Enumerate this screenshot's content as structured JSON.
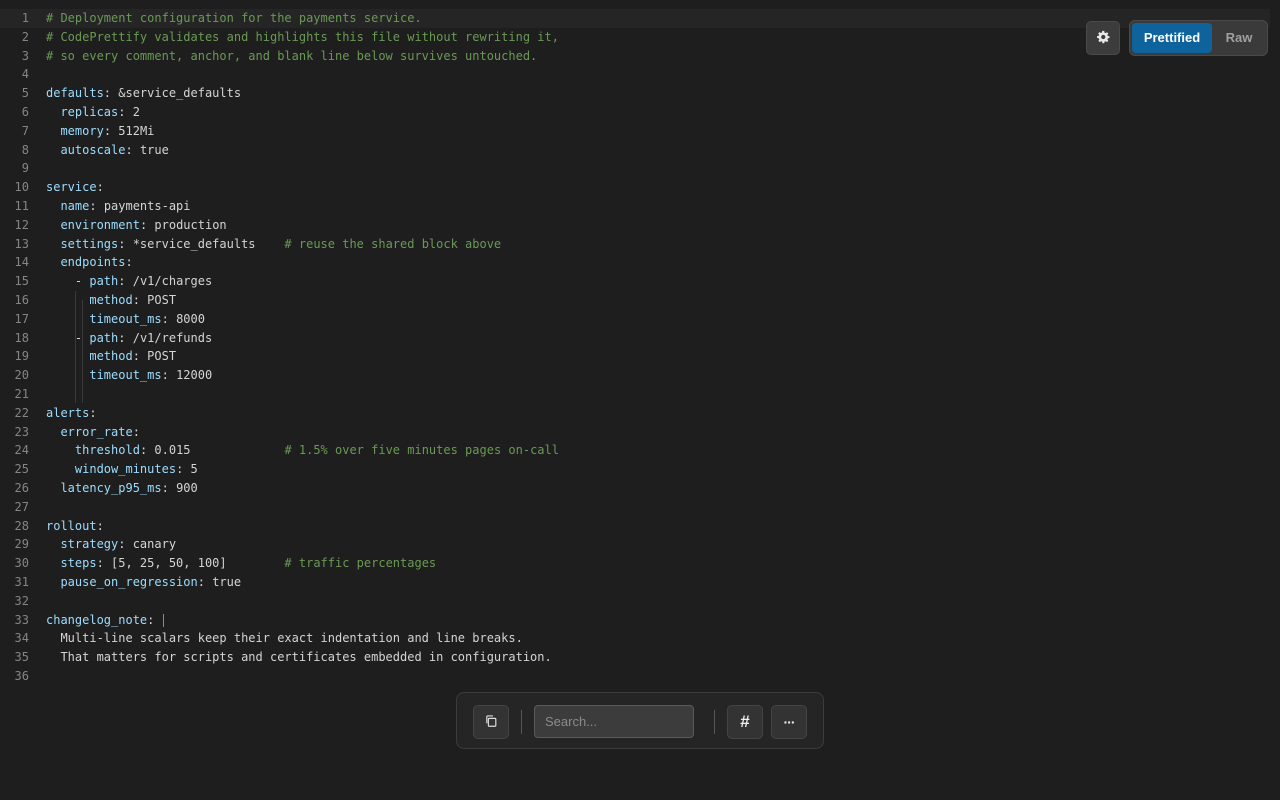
{
  "toolbar": {
    "prettified_label": "Prettified",
    "raw_label": "Raw",
    "active_view": "Prettified",
    "settings_icon": "gear-icon"
  },
  "search": {
    "placeholder": "Search..."
  },
  "bottom_bar": {
    "copy_icon": "copy-icon",
    "line_numbers_icon": "hash-icon",
    "line_numbers_glyph": "#",
    "more_icon": "more-icon",
    "more_glyph": "···"
  },
  "colors": {
    "background": "#1e1e1e",
    "comment": "#6a9955",
    "key": "#9cdcfe",
    "accent": "#0e639c"
  },
  "editor": {
    "current_line": 1,
    "lines": [
      {
        "n": "1",
        "tokens": [
          {
            "c": "comment",
            "t": "# Deployment configuration for the payments service."
          }
        ]
      },
      {
        "n": "2",
        "tokens": [
          {
            "c": "comment",
            "t": "# CodePrettify validates and highlights this file without rewriting it,"
          }
        ]
      },
      {
        "n": "3",
        "tokens": [
          {
            "c": "comment",
            "t": "# so every comment, anchor, and blank line below survives untouched."
          }
        ]
      },
      {
        "n": "4",
        "tokens": []
      },
      {
        "n": "5",
        "tokens": [
          {
            "c": "key",
            "t": "defaults"
          },
          {
            "c": "punct",
            "t": ": "
          },
          {
            "c": "val",
            "t": "&service_defaults"
          }
        ]
      },
      {
        "n": "6",
        "tokens": [
          {
            "c": "val",
            "t": "  "
          },
          {
            "c": "key",
            "t": "replicas"
          },
          {
            "c": "punct",
            "t": ": "
          },
          {
            "c": "val",
            "t": "2"
          }
        ]
      },
      {
        "n": "7",
        "tokens": [
          {
            "c": "val",
            "t": "  "
          },
          {
            "c": "key",
            "t": "memory"
          },
          {
            "c": "punct",
            "t": ": "
          },
          {
            "c": "val",
            "t": "512Mi"
          }
        ]
      },
      {
        "n": "8",
        "tokens": [
          {
            "c": "val",
            "t": "  "
          },
          {
            "c": "key",
            "t": "autoscale"
          },
          {
            "c": "punct",
            "t": ": "
          },
          {
            "c": "val",
            "t": "true"
          }
        ]
      },
      {
        "n": "9",
        "tokens": []
      },
      {
        "n": "10",
        "tokens": [
          {
            "c": "key",
            "t": "service"
          },
          {
            "c": "punct",
            "t": ":"
          }
        ]
      },
      {
        "n": "11",
        "tokens": [
          {
            "c": "val",
            "t": "  "
          },
          {
            "c": "key",
            "t": "name"
          },
          {
            "c": "punct",
            "t": ": "
          },
          {
            "c": "val",
            "t": "payments-api"
          }
        ]
      },
      {
        "n": "12",
        "tokens": [
          {
            "c": "val",
            "t": "  "
          },
          {
            "c": "key",
            "t": "environment"
          },
          {
            "c": "punct",
            "t": ": "
          },
          {
            "c": "val",
            "t": "production"
          }
        ]
      },
      {
        "n": "13",
        "tokens": [
          {
            "c": "val",
            "t": "  "
          },
          {
            "c": "key",
            "t": "settings"
          },
          {
            "c": "punct",
            "t": ": "
          },
          {
            "c": "val",
            "t": "*service_defaults    "
          },
          {
            "c": "comment",
            "t": "# reuse the shared block above"
          }
        ]
      },
      {
        "n": "14",
        "tokens": [
          {
            "c": "val",
            "t": "  "
          },
          {
            "c": "key",
            "t": "endpoints"
          },
          {
            "c": "punct",
            "t": ":"
          }
        ]
      },
      {
        "n": "15",
        "tokens": [
          {
            "c": "val",
            "t": "    - "
          },
          {
            "c": "key",
            "t": "path"
          },
          {
            "c": "punct",
            "t": ": "
          },
          {
            "c": "val",
            "t": "/v1/charges"
          }
        ]
      },
      {
        "n": "16",
        "tokens": [
          {
            "c": "val",
            "t": "      "
          },
          {
            "c": "key",
            "t": "method"
          },
          {
            "c": "punct",
            "t": ": "
          },
          {
            "c": "val",
            "t": "POST"
          }
        ]
      },
      {
        "n": "17",
        "tokens": [
          {
            "c": "val",
            "t": "      "
          },
          {
            "c": "key",
            "t": "timeout_ms"
          },
          {
            "c": "punct",
            "t": ": "
          },
          {
            "c": "val",
            "t": "8000"
          }
        ]
      },
      {
        "n": "18",
        "tokens": [
          {
            "c": "val",
            "t": "    - "
          },
          {
            "c": "key",
            "t": "path"
          },
          {
            "c": "punct",
            "t": ": "
          },
          {
            "c": "val",
            "t": "/v1/refunds"
          }
        ]
      },
      {
        "n": "19",
        "tokens": [
          {
            "c": "val",
            "t": "      "
          },
          {
            "c": "key",
            "t": "method"
          },
          {
            "c": "punct",
            "t": ": "
          },
          {
            "c": "val",
            "t": "POST"
          }
        ]
      },
      {
        "n": "20",
        "tokens": [
          {
            "c": "val",
            "t": "      "
          },
          {
            "c": "key",
            "t": "timeout_ms"
          },
          {
            "c": "punct",
            "t": ": "
          },
          {
            "c": "val",
            "t": "12000"
          }
        ]
      },
      {
        "n": "21",
        "tokens": []
      },
      {
        "n": "22",
        "tokens": [
          {
            "c": "key",
            "t": "alerts"
          },
          {
            "c": "punct",
            "t": ":"
          }
        ]
      },
      {
        "n": "23",
        "tokens": [
          {
            "c": "val",
            "t": "  "
          },
          {
            "c": "key",
            "t": "error_rate"
          },
          {
            "c": "punct",
            "t": ":"
          }
        ]
      },
      {
        "n": "24",
        "tokens": [
          {
            "c": "val",
            "t": "    "
          },
          {
            "c": "key",
            "t": "threshold"
          },
          {
            "c": "punct",
            "t": ": "
          },
          {
            "c": "val",
            "t": "0.015             "
          },
          {
            "c": "comment",
            "t": "# 1.5% over five minutes pages on-call"
          }
        ]
      },
      {
        "n": "25",
        "tokens": [
          {
            "c": "val",
            "t": "    "
          },
          {
            "c": "key",
            "t": "window_minutes"
          },
          {
            "c": "punct",
            "t": ": "
          },
          {
            "c": "val",
            "t": "5"
          }
        ]
      },
      {
        "n": "26",
        "tokens": [
          {
            "c": "val",
            "t": "  "
          },
          {
            "c": "key",
            "t": "latency_p95_ms"
          },
          {
            "c": "punct",
            "t": ": "
          },
          {
            "c": "val",
            "t": "900"
          }
        ]
      },
      {
        "n": "27",
        "tokens": []
      },
      {
        "n": "28",
        "tokens": [
          {
            "c": "key",
            "t": "rollout"
          },
          {
            "c": "punct",
            "t": ":"
          }
        ]
      },
      {
        "n": "29",
        "tokens": [
          {
            "c": "val",
            "t": "  "
          },
          {
            "c": "key",
            "t": "strategy"
          },
          {
            "c": "punct",
            "t": ": "
          },
          {
            "c": "val",
            "t": "canary"
          }
        ]
      },
      {
        "n": "30",
        "tokens": [
          {
            "c": "val",
            "t": "  "
          },
          {
            "c": "key",
            "t": "steps"
          },
          {
            "c": "punct",
            "t": ": "
          },
          {
            "c": "val",
            "t": "[5, 25, 50, 100]        "
          },
          {
            "c": "comment",
            "t": "# traffic percentages"
          }
        ]
      },
      {
        "n": "31",
        "tokens": [
          {
            "c": "val",
            "t": "  "
          },
          {
            "c": "key",
            "t": "pause_on_regression"
          },
          {
            "c": "punct",
            "t": ": "
          },
          {
            "c": "val",
            "t": "true"
          }
        ]
      },
      {
        "n": "32",
        "tokens": []
      },
      {
        "n": "33",
        "tokens": [
          {
            "c": "key",
            "t": "changelog_note"
          },
          {
            "c": "punct",
            "t": ": "
          },
          {
            "c": "cursor",
            "t": ""
          }
        ]
      },
      {
        "n": "34",
        "tokens": [
          {
            "c": "val",
            "t": "  Multi-line scalars keep their exact indentation and line breaks."
          }
        ]
      },
      {
        "n": "35",
        "tokens": [
          {
            "c": "val",
            "t": "  That matters for scripts and certificates embedded in configuration."
          }
        ]
      },
      {
        "n": "36",
        "tokens": []
      }
    ]
  }
}
